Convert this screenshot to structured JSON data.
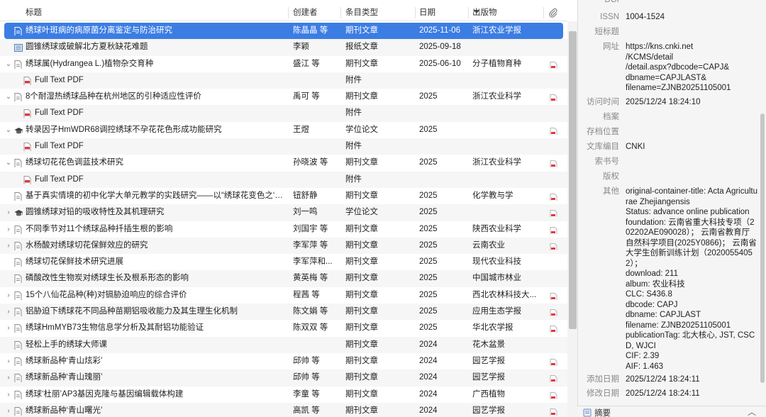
{
  "columns": {
    "title": "标题",
    "creator": "创建者",
    "item_type": "条目类型",
    "date": "日期",
    "publication": "出版物"
  },
  "rows": [
    {
      "kind": "item",
      "twisty": "",
      "icon": "journal-article-icon",
      "title": "绣球叶斑病的病原菌分离鉴定与防治研究",
      "creator": "陈晶晶 等",
      "type": "期刊文章",
      "date": "2025-11-06",
      "pub": "浙江农业学报",
      "att": false,
      "selected": true
    },
    {
      "kind": "item",
      "twisty": "",
      "icon": "newspaper-article-icon",
      "title": "圆锥绣球或破解北方夏秋缺花难题",
      "creator": "李颖",
      "type": "报纸文章",
      "date": "2025-09-18",
      "pub": "",
      "att": false
    },
    {
      "kind": "item",
      "twisty": "⌄",
      "icon": "journal-article-icon",
      "title": "绣球属(Hydrangea L.)植物杂交育种",
      "creator": "盛江 等",
      "type": "期刊文章",
      "date": "2025-06-10",
      "pub": "分子植物育种",
      "att": true
    },
    {
      "kind": "attachment",
      "twisty": "",
      "icon": "pdf-icon",
      "title": "Full Text PDF",
      "creator": "",
      "type": "附件",
      "date": "",
      "pub": "",
      "att": false
    },
    {
      "kind": "item",
      "twisty": "⌄",
      "icon": "journal-article-icon",
      "title": "8个耐湿热绣球品种在杭州地区的引种适应性评价",
      "creator": "禹可 等",
      "type": "期刊文章",
      "date": "2025",
      "pub": "浙江农业科学",
      "att": true
    },
    {
      "kind": "attachment",
      "twisty": "",
      "icon": "pdf-icon",
      "title": "Full Text PDF",
      "creator": "",
      "type": "附件",
      "date": "",
      "pub": "",
      "att": false
    },
    {
      "kind": "item",
      "twisty": "⌄",
      "icon": "thesis-icon",
      "title": "转录因子HmWDR68调控绣球不孕花花色形成功能研究",
      "creator": "王煜",
      "type": "学位论文",
      "date": "2025",
      "pub": "",
      "att": true
    },
    {
      "kind": "attachment",
      "twisty": "",
      "icon": "pdf-icon",
      "title": "Full Text PDF",
      "creator": "",
      "type": "附件",
      "date": "",
      "pub": "",
      "att": false
    },
    {
      "kind": "item",
      "twisty": "⌄",
      "icon": "journal-article-icon",
      "title": "绣球切花花色调蓝技术研究",
      "creator": "孙晓波 等",
      "type": "期刊文章",
      "date": "2025",
      "pub": "浙江农业科学",
      "att": true
    },
    {
      "kind": "attachment",
      "twisty": "",
      "icon": "pdf-icon",
      "title": "Full Text PDF",
      "creator": "",
      "type": "附件",
      "date": "",
      "pub": "",
      "att": false
    },
    {
      "kind": "item",
      "twisty": "",
      "icon": "journal-article-icon",
      "title": "基于真实情境的初中化学大单元教学的实践研究——以“绣球花变色之‘铝’”...",
      "creator": "钮舒静",
      "type": "期刊文章",
      "date": "2025",
      "pub": "化学教与学",
      "att": true
    },
    {
      "kind": "item",
      "twisty": "›",
      "icon": "thesis-icon",
      "title": "圆锥绣球对铅的吸收特性及其机理研究",
      "creator": "刘一鸣",
      "type": "学位论文",
      "date": "2025",
      "pub": "",
      "att": true
    },
    {
      "kind": "item",
      "twisty": "›",
      "icon": "journal-article-icon",
      "title": "不同季节对11个绣球品种扦插生根的影响",
      "creator": "刘国宇 等",
      "type": "期刊文章",
      "date": "2025",
      "pub": "陕西农业科学",
      "att": true
    },
    {
      "kind": "item",
      "twisty": "›",
      "icon": "journal-article-icon",
      "title": "水杨酸对绣球切花保鲜效应的研究",
      "creator": "李军萍 等",
      "type": "期刊文章",
      "date": "2025",
      "pub": "云南农业",
      "att": true
    },
    {
      "kind": "item",
      "twisty": "",
      "icon": "journal-article-icon",
      "title": "绣球切花保鲜技术研究进展",
      "creator": "李军萍和...",
      "type": "期刊文章",
      "date": "2025",
      "pub": "现代农业科技",
      "att": false
    },
    {
      "kind": "item",
      "twisty": "",
      "icon": "journal-article-icon",
      "title": "磷酸改性生物炭对绣球生长及根系形态的影响",
      "creator": "黄英梅 等",
      "type": "期刊文章",
      "date": "2025",
      "pub": "中国城市林业",
      "att": false
    },
    {
      "kind": "item",
      "twisty": "›",
      "icon": "journal-article-icon",
      "title": "15个八仙花品种(种)对镉胁迫响应的综合评价",
      "creator": "程茜 等",
      "type": "期刊文章",
      "date": "2025",
      "pub": "西北农林科技大...",
      "att": true
    },
    {
      "kind": "item",
      "twisty": "›",
      "icon": "journal-article-icon",
      "title": "铝胁迫下绣球花不同品种苗期铝吸收能力及其生理生化机制",
      "creator": "陈文娟 等",
      "type": "期刊文章",
      "date": "2025",
      "pub": "应用生态学报",
      "att": true
    },
    {
      "kind": "item",
      "twisty": "›",
      "icon": "journal-article-icon",
      "title": "绣球HmMYB73生物信息学分析及其耐铝功能验证",
      "creator": "陈双双 等",
      "type": "期刊文章",
      "date": "2025",
      "pub": "华北农学报",
      "att": true
    },
    {
      "kind": "item",
      "twisty": "",
      "icon": "journal-article-icon",
      "title": "轻松上手的绣球大师课",
      "creator": "",
      "type": "期刊文章",
      "date": "2024",
      "pub": "花木盆景",
      "att": false
    },
    {
      "kind": "item",
      "twisty": "›",
      "icon": "journal-article-icon",
      "title": "绣球新品种‘青山炫彩’",
      "creator": "邱帅 等",
      "type": "期刊文章",
      "date": "2024",
      "pub": "园艺学报",
      "att": true
    },
    {
      "kind": "item",
      "twisty": "›",
      "icon": "journal-article-icon",
      "title": "绣球新品种‘青山瑰丽’",
      "creator": "邱帅 等",
      "type": "期刊文章",
      "date": "2024",
      "pub": "园艺学报",
      "att": true
    },
    {
      "kind": "item",
      "twisty": "›",
      "icon": "journal-article-icon",
      "title": "绣球‘杜丽’AP3基因克隆与基因编辑载体构建",
      "creator": "李童 等",
      "type": "期刊文章",
      "date": "2024",
      "pub": "广西植物",
      "att": true
    },
    {
      "kind": "item",
      "twisty": "›",
      "icon": "journal-article-icon",
      "title": "绣球新品种‘青山曙光’",
      "creator": "高凯 等",
      "type": "期刊文章",
      "date": "2024",
      "pub": "园艺学报",
      "att": true
    }
  ],
  "info": {
    "top_label": "DOI",
    "fields": [
      {
        "label": "ISSN",
        "value": "1004-1524"
      },
      {
        "label": "短标题",
        "value": ""
      },
      {
        "label": "网址",
        "value": "https://kns.cnki.net\n/KCMS/detail\n/detail.aspx?dbcode=CAPJ&\ndbname=CAPJLAST&\nfilename=ZJNB20251105001"
      },
      {
        "label": "访问时间",
        "value": "2025/12/24 18:24:10"
      },
      {
        "label": "档案",
        "value": ""
      },
      {
        "label": "存档位置",
        "value": ""
      },
      {
        "label": "文库编目",
        "value": "CNKI"
      },
      {
        "label": "索书号",
        "value": ""
      },
      {
        "label": "版权",
        "value": ""
      },
      {
        "label": "其他",
        "value": "original-container-title: Acta Agriculturae Zhejiangensis\nStatus: advance online publication\nfoundation: 云南省重大科技专项（202202AE090028）； 云南省教育厅自然科学项目(2025Y0866)； 云南省大学生创新训练计划（20200554052）；\ndownload: 211\nalbum: 农业科技\nCLC: S436.8\ndbcode: CAPJ\ndbname: CAPJLAST\nfilename: ZJNB20251105001\npublicationTag: 北大核心, JST, CSCD, WJCI\nCIF: 2.39\nAIF: 1.463"
      },
      {
        "label": "添加日期",
        "value": "2025/12/24 18:24:11"
      },
      {
        "label": "修改日期",
        "value": "2025/12/24 18:24:11"
      }
    ],
    "abstract_label": "摘要"
  }
}
